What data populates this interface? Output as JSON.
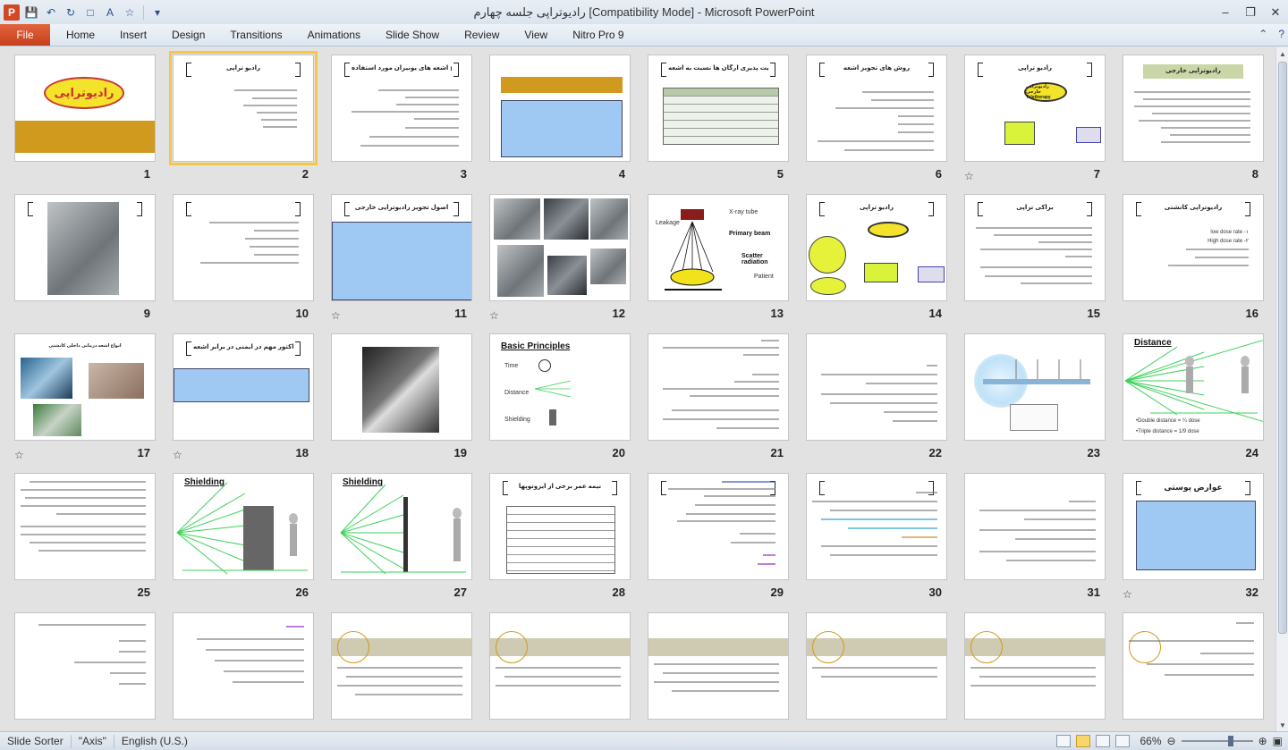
{
  "window": {
    "title": "رادیوتراپی جلسه چهارم [Compatibility Mode]  -  Microsoft PowerPoint",
    "app_icon": "P"
  },
  "ribbon": {
    "file_tab": "File",
    "tabs": [
      "Home",
      "Insert",
      "Design",
      "Transitions",
      "Animations",
      "Slide Show",
      "Review",
      "View",
      "Nitro Pro 9"
    ]
  },
  "slides": {
    "numbers": [
      "1",
      "2",
      "3",
      "4",
      "5",
      "6",
      "7",
      "8",
      "9",
      "10",
      "11",
      "12",
      "13",
      "14",
      "15",
      "16",
      "17",
      "18",
      "19",
      "20",
      "21",
      "22",
      "23",
      "24",
      "25",
      "26",
      "27",
      "28",
      "29",
      "30",
      "31",
      "32"
    ],
    "s1_title": "رادیوتراپی",
    "s2_title": "رادیو تراپی",
    "s3_title": "انواع اشعه های یونیزان مورد استفاده",
    "s5_title": "حساسیت پذیری ارگان ها نسبت به اشعه",
    "s6_title": "روش های تجویز اشعه",
    "s7_title": "رادیو تراپی",
    "s7_oval": "رادیوتراپی خارجی Teletherapy",
    "s8_title": "رادیوتراپی خارجی",
    "s10_title": "",
    "s11_title": "اصول تجویز رادیوتراپی خارجی",
    "s13_label_tube": "X-ray tube",
    "s13_label_leakage": "Leakage",
    "s13_label_primary": "Primary beam",
    "s13_label_scatter": "Scatter radiation",
    "s13_label_patient": "Patient",
    "s14_title": "رادیو تراپی",
    "s15_title": "براکی تراپی",
    "s16_title": "رادیوتراپی کانشتی",
    "s16_lines": [
      "low dose rate -۱",
      "High dose rate -۲"
    ],
    "s17_title": "انواع اشعه درمانی داخلی کانشتی",
    "s18_title": "سه فاکتور مهم در ایمنی در برابر اشعه",
    "s20_title": "Basic Principles",
    "s20_items": [
      "Time",
      "Distance",
      "Shielding"
    ],
    "s24_title": "Distance",
    "s24_notes": [
      "•Double  distance  =  ¼ dose",
      "•Triple distance  =  1/9 dose"
    ],
    "s26_title": "Shielding",
    "s27_title": "Shielding",
    "s28_title": "نیمه عمر برخی از ایزوتوپها",
    "s32_title": "عوارض پوستی"
  },
  "status": {
    "view": "Slide Sorter",
    "theme": "\"Axis\"",
    "language": "English (U.S.)",
    "zoom": "66%"
  },
  "colors": {
    "file_tab": "#d24726",
    "selection": "#f4c842"
  }
}
